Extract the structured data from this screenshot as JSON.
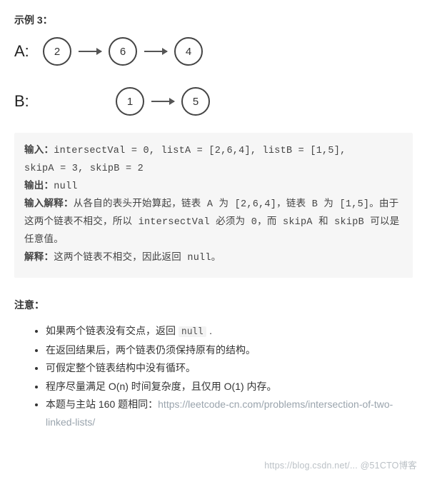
{
  "example_heading": "示例 3：",
  "listA": {
    "label": "A:",
    "nodes": [
      "2",
      "6",
      "4"
    ]
  },
  "listB": {
    "label": "B:",
    "nodes": [
      "1",
      "5"
    ]
  },
  "codeblock": {
    "input_label": "输入：",
    "input_text1": "intersectVal = 0, listA = [2,6,4], listB = [1,5],",
    "input_text2": "skipA = 3, skipB = 2",
    "output_label": "输出：",
    "output_text": "null",
    "input_exp_label": "输入解释：",
    "input_exp_text": "从各自的表头开始算起，链表 A 为 [2,6,4]，链表 B 为 [1,5]。由于这两个链表不相交，所以 intersectVal 必须为 0，而 skipA 和 skipB 可以是任意值。",
    "exp_label": "解释：",
    "exp_text": "这两个链表不相交，因此返回 null。"
  },
  "notes_heading": "注意：",
  "notes": {
    "n0a": "如果两个链表没有交点，返回 ",
    "n0b": "null",
    "n0c": " .",
    "n1": "在返回结果后，两个链表仍须保持原有的结构。",
    "n2": "可假定整个链表结构中没有循环。",
    "n3": "程序尽量满足 O(n) 时间复杂度，且仅用 O(1) 内存。",
    "n4a": "本题与主站 160 题相同：",
    "n4b": "https://leetcode-cn.com/problems/intersection-of-two-linked-lists/"
  },
  "watermark": "https://blog.csdn.net/...   @51CTO博客"
}
